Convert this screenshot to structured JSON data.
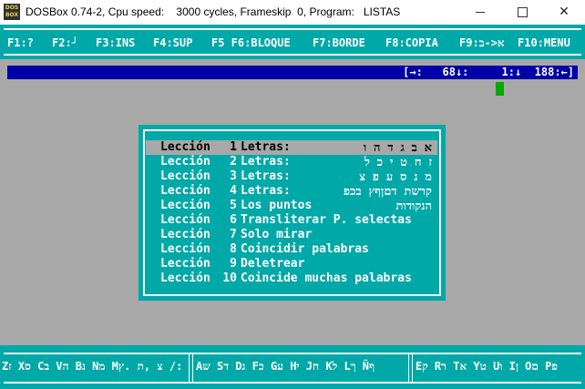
{
  "window": {
    "icon_label_top": "DOS",
    "icon_label_bottom": "BOX",
    "title": "DOSBox 0.74-2, Cpu speed:    3000 cycles, Frameskip  0, Program:   LISTAS",
    "minimize_glyph": "",
    "maximize_glyph": "",
    "close_glyph": "✕"
  },
  "menu": [
    {
      "label": "F1:?"
    },
    {
      "label": "F2:┘"
    },
    {
      "label": "F3:INS"
    },
    {
      "label": "F4:SUP"
    },
    {
      "label": "F5 F6:BLOQUE"
    },
    {
      "label": "F7:BORDE"
    },
    {
      "label": "F8:COPIA"
    },
    {
      "label": "F9:א<-ב"
    },
    {
      "label": "F10:MENU"
    }
  ],
  "status": {
    "text": "[→:   68↓:     1:↓  188:←]"
  },
  "lessons": [
    {
      "word": "Lección",
      "number": "1",
      "title": "Letras:",
      "hebrew": "א ב ג ד ה ו"
    },
    {
      "word": "Lección",
      "number": "2",
      "title": "Letras:",
      "hebrew": "ז ח ט י כ ל"
    },
    {
      "word": "Lección",
      "number": "3",
      "title": "Letras:",
      "hebrew": "מ נ ס ע פ צ"
    },
    {
      "word": "Lección",
      "number": "4",
      "title": "Letras:",
      "hebrew": "קרשת דםןףץ בכפ"
    },
    {
      "word": "Lección",
      "number": "5",
      "title": "Los puntos",
      "hebrew": "הנקודות"
    },
    {
      "word": "Lección",
      "number": "6",
      "title": "Transliterar P. selectas",
      "hebrew": ""
    },
    {
      "word": "Lección",
      "number": "7",
      "title": "Solo mirar",
      "hebrew": ""
    },
    {
      "word": "Lección",
      "number": "8",
      "title": "Coincidir palabras",
      "hebrew": ""
    },
    {
      "word": "Lección",
      "number": "9",
      "title": "Deletrear",
      "hebrew": ""
    },
    {
      "word": "Lección",
      "number": "10",
      "title": "Coincide muchas palabras",
      "hebrew": ""
    }
  ],
  "keyboard": {
    "segment_1": "Zז Xס Cב Vה Bנ Nמ Mצ ,ת .ץ /:",
    "segment_2": "Aש Sד Dג Fכ Gע Hי Jח Kל Lך Ñף",
    "segment_3": "Eק Rר Tא Yט Uו Iן Oם Pפ"
  },
  "colors": {
    "cyan": "#00a8a8",
    "gray": "#a8a8a8",
    "blue": "#0000a8",
    "green": "#00a800"
  }
}
